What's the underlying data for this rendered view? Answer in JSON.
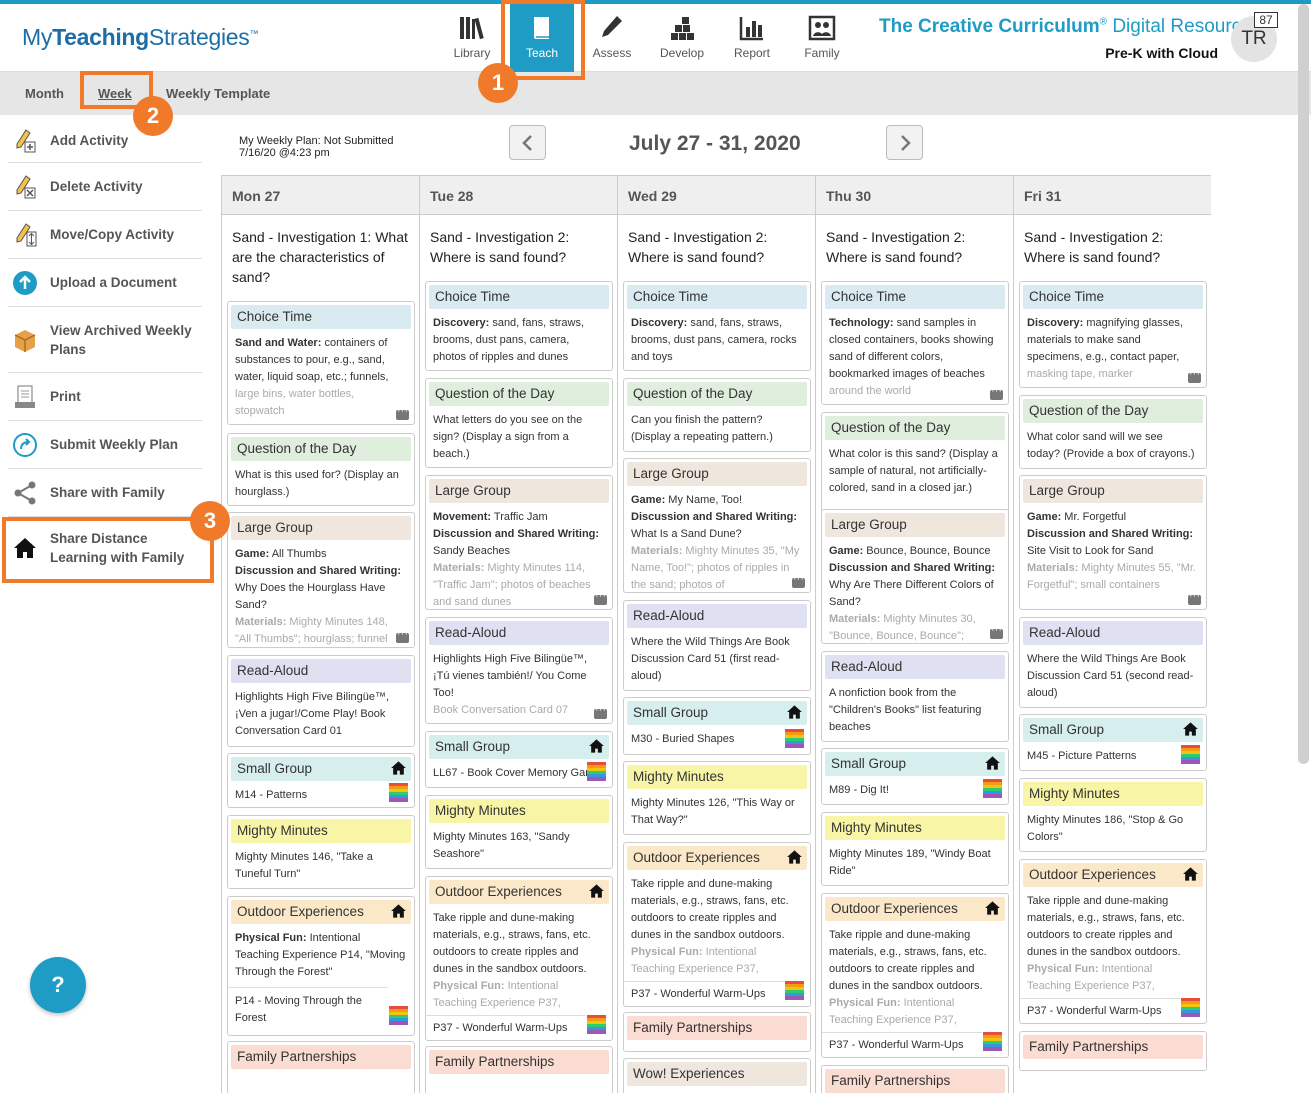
{
  "app": {
    "logo_part1": "My",
    "logo_part2": "Teaching",
    "logo_part3": "Strategies",
    "logo_tm": "™"
  },
  "nav": [
    {
      "label": "Library",
      "icon": "books-icon"
    },
    {
      "label": "Teach",
      "icon": "book-icon",
      "active": true
    },
    {
      "label": "Assess",
      "icon": "pencil-icon"
    },
    {
      "label": "Develop",
      "icon": "blocks-icon"
    },
    {
      "label": "Report",
      "icon": "bar-chart-icon"
    },
    {
      "label": "Family",
      "icon": "family-photo-icon"
    }
  ],
  "brand": {
    "strong": "The Creative Curriculum",
    "reg": "®",
    "light": " Digital Resources",
    "subtitle": "Pre-K with Cloud"
  },
  "user": {
    "initials": "TR",
    "notifications": "87"
  },
  "subnav": {
    "month": "Month",
    "week": "Week",
    "template": "Weekly Template"
  },
  "sidebar": [
    {
      "label": "Add Activity",
      "icon": "pencil-add-icon"
    },
    {
      "label": "Delete Activity",
      "icon": "pencil-delete-icon"
    },
    {
      "label": "Move/Copy Activity",
      "icon": "pencil-move-icon"
    },
    {
      "label": "Upload a Document",
      "icon": "upload-icon"
    },
    {
      "label": "View Archived Weekly Plans",
      "icon": "archive-box-icon"
    },
    {
      "label": "Print",
      "icon": "print-icon"
    },
    {
      "label": "Submit Weekly Plan",
      "icon": "submit-icon"
    },
    {
      "label": "Share with Family",
      "icon": "share-icon"
    },
    {
      "label": "Share Distance Learning with Family",
      "icon": "home-icon"
    }
  ],
  "plan": {
    "status": "My Weekly Plan: Not Submitted",
    "date": "7/16/20 @4:23 pm",
    "range": "July 27 - 31, 2020"
  },
  "days": [
    {
      "head": "Mon 27",
      "title": "Sand - Investigation 1: What are the characteristics of sand?"
    },
    {
      "head": "Tue 28",
      "title": "Sand - Investigation 2: Where is sand found?"
    },
    {
      "head": "Wed 29",
      "title": "Sand - Investigation 2: Where is sand found?"
    },
    {
      "head": "Thu 30",
      "title": "Sand - Investigation 2: Where is sand found?"
    },
    {
      "head": "Fri 31",
      "title": "Sand - Investigation 2: Where is sand found?"
    }
  ],
  "cards": {
    "mon": {
      "choice": {
        "head": "Choice Time",
        "label": "Sand and Water:",
        "text": " containers of substances to pour, e.g., sand, water, liquid soap, etc.; funnels,",
        "fade": "large bins, water bottles, stopwatch"
      },
      "qotd": {
        "head": "Question of the Day",
        "text": "What is this used for? (Display an hourglass.)"
      },
      "large": {
        "head": "Large Group",
        "l1": "Game:",
        "t1": " All Thumbs",
        "l2": "Discussion and Shared Writing:",
        "t2": " Why Does the Hourglass Have Sand?",
        "l3": "Materials:",
        "fade": " Mighty Minutes 148, \"All Thumbs\"; hourglass; funnel"
      },
      "read": {
        "head": "Read-Aloud",
        "text": "Highlights High Five Bilingüe™, ¡Ven a jugar!/Come Play! Book Conversation Card 01"
      },
      "small": {
        "head": "Small Group",
        "text": "M14 - Patterns"
      },
      "mighty": {
        "head": "Mighty Minutes",
        "text": "Mighty Minutes 146, \"Take a Tuneful Turn\""
      },
      "outdoor": {
        "head": "Outdoor Experiences",
        "label": "Physical Fun:",
        "text": " Intentional Teaching Experience P14, \"Moving Through the Forest\"",
        "sub": "P14 - Moving Through the Forest"
      },
      "family": {
        "head": "Family Partnerships"
      }
    },
    "tue": {
      "choice": {
        "head": "Choice Time",
        "label": "Discovery:",
        "text": " sand, fans, straws, brooms, dust pans, camera, photos of ripples and dunes"
      },
      "qotd": {
        "head": "Question of the Day",
        "text": "What letters do you see on the sign? (Display a sign from a beach.)"
      },
      "large": {
        "head": "Large Group",
        "l1": "Movement:",
        "t1": " Traffic Jam",
        "l2": "Discussion and Shared Writing:",
        "t2": " Sandy Beaches",
        "l3": "Materials:",
        "fade": " Mighty Minutes 114, \"Traffic Jam\"; photos of beaches and sand dunes"
      },
      "read": {
        "head": "Read-Aloud",
        "text": "Highlights High Five Bilingüe™, ¡Tú vienes también!/ You Come Too!",
        "fade": "Book Conversation Card 07"
      },
      "small": {
        "head": "Small Group",
        "text": "LL67 - Book Cover Memory Game"
      },
      "mighty": {
        "head": "Mighty Minutes",
        "text": "Mighty Minutes 163, \"Sandy Seashore\""
      },
      "outdoor": {
        "head": "Outdoor Experiences",
        "text": "Take ripple and dune-making materials, e.g., straws, fans, etc. outdoors to create ripples and dunes in the sandbox outdoors.",
        "label": "Physical Fun:",
        "fade": " Intentional Teaching Experience P37,",
        "sub": "P37 - Wonderful Warm-Ups"
      },
      "family": {
        "head": "Family Partnerships"
      }
    },
    "wed": {
      "choice": {
        "head": "Choice Time",
        "label": "Discovery:",
        "text": " sand, fans, straws, brooms, dust pans, camera, rocks and toys"
      },
      "qotd": {
        "head": "Question of the Day",
        "text": "Can you finish the pattern? (Display a repeating pattern.)"
      },
      "large": {
        "head": "Large Group",
        "l1": "Game:",
        "t1": " My Name, Too!",
        "l2": "Discussion and Shared Writing:",
        "t2": " What Is a Sand Dune?",
        "l3": "Materials:",
        "fade": " Mighty Minutes 35, \"My Name, Too!\"; photos of ripples in the sand; photos of"
      },
      "read": {
        "head": "Read-Aloud",
        "text": "Where the Wild Things Are Book Discussion Card 51 (first read-aloud)"
      },
      "small": {
        "head": "Small Group",
        "text": "M30 - Buried Shapes"
      },
      "mighty": {
        "head": "Mighty Minutes",
        "text": "Mighty Minutes 126, \"This Way or That Way?\""
      },
      "outdoor": {
        "head": "Outdoor Experiences",
        "text": "Take ripple and dune-making materials, e.g., straws, fans, etc. outdoors to create ripples and dunes in the sandbox outdoors.",
        "label": "Physical Fun:",
        "fade": " Intentional Teaching Experience P37,",
        "sub": "P37 - Wonderful Warm-Ups"
      },
      "family": {
        "head": "Family Partnerships"
      },
      "wow": {
        "head": "Wow! Experiences"
      }
    },
    "thu": {
      "choice": {
        "head": "Choice Time",
        "label": "Technology:",
        "text": " sand samples in closed containers, books showing sand of different colors, bookmarked images of beaches",
        "fade": "around the world"
      },
      "qotd": {
        "head": "Question of the Day",
        "text": "What color is this sand? (Display a sample of natural, not artificially-colored, sand in a closed jar.)"
      },
      "large": {
        "head": "Large Group",
        "l1": "Game:",
        "t1": " Bounce, Bounce, Bounce",
        "l2": "Discussion and Shared Writing:",
        "t2": " Why Are There Different Colors of Sand?",
        "l3": "Materials:",
        "fade": " Mighty Minutes 30, \"Bounce, Bounce, Bounce\";"
      },
      "read": {
        "head": "Read-Aloud",
        "text": "A nonfiction book from the \"Children's Books\" list featuring beaches"
      },
      "small": {
        "head": "Small Group",
        "text": "M89 - Dig It!"
      },
      "mighty": {
        "head": "Mighty Minutes",
        "text": "Mighty Minutes 189, \"Windy Boat Ride\""
      },
      "outdoor": {
        "head": "Outdoor Experiences",
        "text": "Take ripple and dune-making materials, e.g., straws, fans, etc. outdoors to create ripples and dunes in the sandbox outdoors.",
        "label": "Physical Fun:",
        "fade": " Intentional Teaching Experience P37,",
        "sub": "P37 - Wonderful Warm-Ups"
      },
      "family": {
        "head": "Family Partnerships"
      }
    },
    "fri": {
      "choice": {
        "head": "Choice Time",
        "label": "Discovery:",
        "text": " magnifying glasses, materials to make sand specimens, e.g., contact paper,",
        "fade": "masking tape, marker"
      },
      "qotd": {
        "head": "Question of the Day",
        "text": "What color sand will we see today? (Provide a box of crayons.)"
      },
      "large": {
        "head": "Large Group",
        "l1": "Game:",
        "t1": " Mr. Forgetful",
        "l2": "Discussion and Shared Writing:",
        "t2": " Site Visit to Look for Sand",
        "l3": "Materials:",
        "fade": " Mighty Minutes 55, \"Mr. Forgetful\"; small containers"
      },
      "read": {
        "head": "Read-Aloud",
        "text": "Where the Wild Things Are Book Discussion Card 51 (second read-aloud)"
      },
      "small": {
        "head": "Small Group",
        "text": "M45 - Picture Patterns"
      },
      "mighty": {
        "head": "Mighty Minutes",
        "text": "Mighty Minutes 186, \"Stop & Go Colors\""
      },
      "outdoor": {
        "head": "Outdoor Experiences",
        "text": "Take ripple and dune-making materials, e.g., straws, fans, etc. outdoors to create ripples and dunes in the sandbox outdoors.",
        "label": "Physical Fun:",
        "fade": " Intentional Teaching Experience P37,",
        "sub": "P37 - Wonderful Warm-Ups"
      },
      "family": {
        "head": "Family Partnerships"
      }
    }
  },
  "annotations": [
    "1",
    "2",
    "3"
  ],
  "help": "?",
  "colors": {
    "accent": "#1e9cc6",
    "annotation": "#f07a2a",
    "choice": "#d9eaf1",
    "qotd": "#dfeedd",
    "large": "#efe7dd",
    "read": "#dfe0f1",
    "small": "#d7eeee",
    "mighty": "#f8f5a6",
    "outdoor": "#fbe8c8",
    "family": "#fbdcd2"
  }
}
